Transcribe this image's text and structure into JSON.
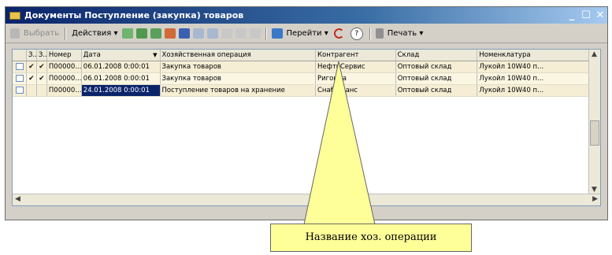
{
  "window": {
    "title": "Документы Поступление (закупка) товаров",
    "minimize": "_",
    "maximize": "☐",
    "close": "✕"
  },
  "toolbar": {
    "select_label": "Выбрать",
    "actions_label": "Действия ▾",
    "goto_label": "Перейти ▾",
    "help_label": "?",
    "print_label": "Печать ▾"
  },
  "table": {
    "columns": [
      "",
      "З..",
      "З..",
      "Номер",
      "Дата",
      "Хозяйственная операция",
      "Контрагент",
      "Склад",
      "Номенклатура"
    ],
    "rows": [
      {
        "icon": "document-icon",
        "c1": "✔",
        "c2": "✔",
        "number": "П00000...",
        "date": "06.01.2008 0:00:01",
        "operation": "Закупка товаров",
        "counterparty": "НефтьСервис",
        "warehouse": "Оптовый склад",
        "nomenclature": "Лукойл 10W40 п..."
      },
      {
        "icon": "document-icon",
        "c1": "✔",
        "c2": "✔",
        "number": "П00000...",
        "date": "06.01.2008 0:00:01",
        "operation": "Закупка товаров",
        "counterparty": "Ригонда",
        "warehouse": "Оптовый склад",
        "nomenclature": "Лукойл 10W40 п..."
      },
      {
        "icon": "document-icon",
        "c1": "",
        "c2": "",
        "number": "П00000...",
        "date": "24.01.2008 0:00:01",
        "operation": "Поступление товаров на хранение",
        "counterparty": "Снаб-Транс",
        "warehouse": "Оптовый склад",
        "nomenclature": "Лукойл 10W40 п..."
      }
    ],
    "sort_indicator": "▼"
  },
  "callout": {
    "text": "Название хоз. операции"
  },
  "colors": {
    "title_bar": "#0a246a",
    "window_bg": "#d4d0c8",
    "callout_bg": "#ffff99",
    "selected_cell": "#0a246a"
  }
}
